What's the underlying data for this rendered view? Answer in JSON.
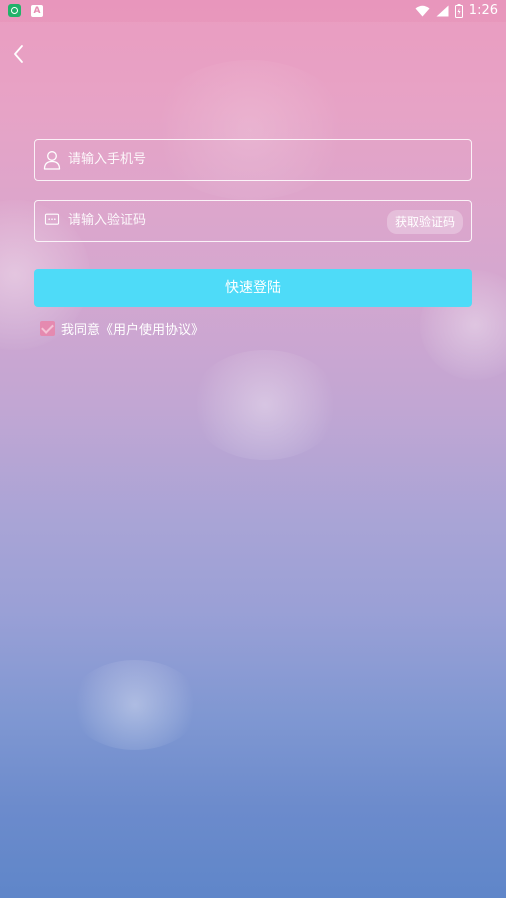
{
  "status_bar": {
    "app_icons": [
      "android-app-icon",
      "a-app-icon"
    ],
    "a_icon_text": "A",
    "time": "1:26",
    "icons": [
      "wifi-icon",
      "signal-icon",
      "battery-icon"
    ]
  },
  "nav": {
    "back_icon": "chevron-left-icon"
  },
  "form": {
    "phone_placeholder": "请输入手机号",
    "code_placeholder": "请输入验证码",
    "get_code_label": "获取验证码",
    "login_label": "快速登陆",
    "agree_text": "我同意《用户使用协议》",
    "agree_checked": true
  },
  "colors": {
    "login_button": "#4edbf8",
    "checkbox": "#e58ab0",
    "background_top": "#ea9cc0",
    "background_bottom": "#5f86c9"
  }
}
